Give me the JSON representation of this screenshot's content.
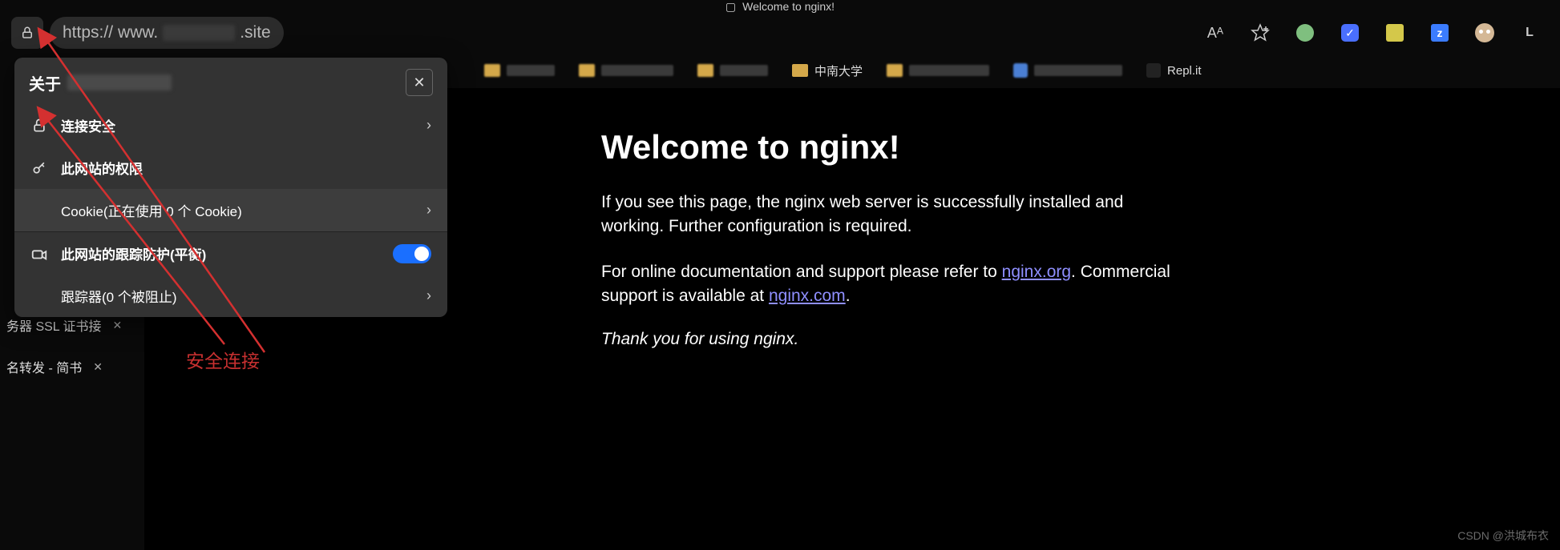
{
  "tab": {
    "title": "Welcome to nginx!"
  },
  "address": {
    "scheme": "https://",
    "host_prefix": "www.",
    "host_suffix": ".site",
    "full": "https://www.l________.site"
  },
  "toolbar_icons": {
    "read_aloud": "Aᴬ",
    "favorite": "☆⁺",
    "letter": "L"
  },
  "bookmarks": {
    "item_cn": "中南大学",
    "item_replit": "Repl.it"
  },
  "side_tabs": {
    "ssl": "务器 SSL 证书接",
    "forward": "名转发 - 简书",
    "close": "✕"
  },
  "popup": {
    "title_prefix": "关于",
    "close": "✕",
    "connection_secure": "连接安全",
    "permissions": "此网站的权限",
    "cookies": "Cookie(正在使用 0 个 Cookie)",
    "tracking_protection": "此网站的跟踪防护(平衡)",
    "trackers_blocked": "跟踪器(0 个被阻止)"
  },
  "annotation": {
    "secure_connection": "安全连接"
  },
  "nginx": {
    "title": "Welcome to nginx!",
    "p1": "If you see this page, the nginx web server is successfully installed and working. Further configuration is required.",
    "p2_a": "For online documentation and support please refer to ",
    "p2_link1": "nginx.org",
    "p2_b": ". Commercial support is available at ",
    "p2_link2": "nginx.com",
    "p2_c": ".",
    "thanks": "Thank you for using nginx."
  },
  "watermark": "CSDN @洪城布衣"
}
